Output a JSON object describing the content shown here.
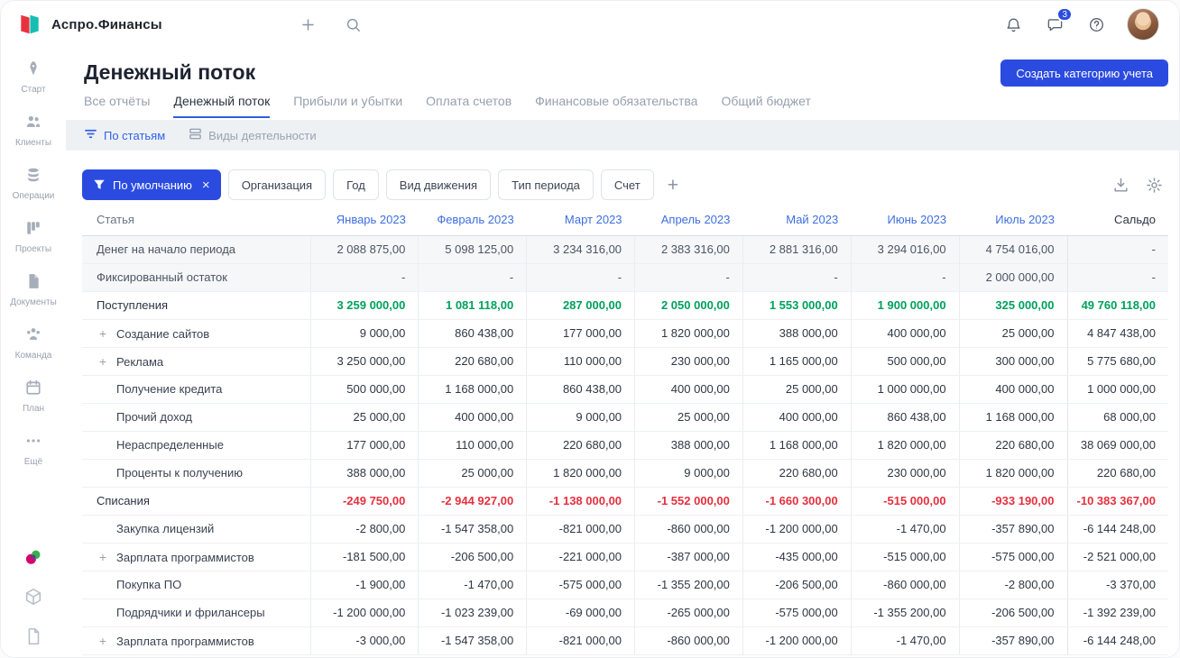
{
  "topbar": {
    "app_name": "Аспро.Финансы",
    "chat_badge": "3"
  },
  "sidebar": {
    "items": [
      {
        "label": "Старт",
        "icon": "rocket"
      },
      {
        "label": "Клиенты",
        "icon": "people"
      },
      {
        "label": "Операции",
        "icon": "coins"
      },
      {
        "label": "Проекты",
        "icon": "kanban"
      },
      {
        "label": "Документы",
        "icon": "doc"
      },
      {
        "label": "Команда",
        "icon": "team"
      },
      {
        "label": "План",
        "icon": "plan"
      },
      {
        "label": "Ещё",
        "icon": "more"
      }
    ]
  },
  "page": {
    "title": "Денежный поток",
    "create_button": "Создать категорию учета",
    "tabs": [
      {
        "label": "Все отчёты",
        "active": false
      },
      {
        "label": "Денежный поток",
        "active": true
      },
      {
        "label": "Прибыли и убытки",
        "active": false
      },
      {
        "label": "Оплата счетов",
        "active": false
      },
      {
        "label": "Финансовые обязательства",
        "active": false
      },
      {
        "label": "Общий бюджет",
        "active": false
      }
    ],
    "subtabs": [
      {
        "label": "По статьям",
        "icon": "by-articles",
        "active": true
      },
      {
        "label": "Виды деятельности",
        "icon": "activity",
        "active": false
      }
    ]
  },
  "filters": {
    "primary": "По умолчанию",
    "chips": [
      "Организация",
      "Год",
      "Вид движения",
      "Тип периода",
      "Счет"
    ]
  },
  "table": {
    "columns": [
      "Статья",
      "Январь 2023",
      "Февраль 2023",
      "Март 2023",
      "Апрель 2023",
      "Май 2023",
      "Июнь 2023",
      "Июль 2023",
      "Сальдо"
    ],
    "rows": [
      {
        "label": "Денег на начало периода",
        "style": "muted",
        "expandable": false,
        "child": false,
        "values": [
          "2 088 875,00",
          "5 098 125,00",
          "3 234 316,00",
          "2 383 316,00",
          "2 881 316,00",
          "3 294 016,00",
          "4 754 016,00",
          "-"
        ]
      },
      {
        "label": "Фиксированный остаток",
        "style": "muted",
        "expandable": false,
        "child": false,
        "values": [
          "-",
          "-",
          "-",
          "-",
          "-",
          "-",
          "2 000 000,00",
          "-"
        ]
      },
      {
        "label": "Поступления",
        "style": "green",
        "expandable": false,
        "child": false,
        "values": [
          "3 259 000,00",
          "1 081 118,00",
          "287 000,00",
          "2 050 000,00",
          "1 553 000,00",
          "1 900 000,00",
          "325 000,00",
          "49 760 118,00"
        ]
      },
      {
        "label": "Создание сайтов",
        "style": "",
        "expandable": true,
        "child": false,
        "values": [
          "9 000,00",
          "860 438,00",
          "177 000,00",
          "1 820 000,00",
          "388 000,00",
          "400 000,00",
          "25 000,00",
          "4 847 438,00"
        ]
      },
      {
        "label": "Реклама",
        "style": "",
        "expandable": true,
        "child": false,
        "values": [
          "3 250 000,00",
          "220 680,00",
          "110 000,00",
          "230 000,00",
          "1 165 000,00",
          "500 000,00",
          "300 000,00",
          "5 775 680,00"
        ]
      },
      {
        "label": "Получение кредита",
        "style": "",
        "expandable": false,
        "child": true,
        "values": [
          "500 000,00",
          "1 168 000,00",
          "860 438,00",
          "400 000,00",
          "25 000,00",
          "1 000 000,00",
          "400 000,00",
          "1 000 000,00"
        ]
      },
      {
        "label": "Прочий доход",
        "style": "",
        "expandable": false,
        "child": true,
        "values": [
          "25 000,00",
          "400 000,00",
          "9 000,00",
          "25 000,00",
          "400 000,00",
          "860 438,00",
          "1 168 000,00",
          "68 000,00"
        ]
      },
      {
        "label": "Нераспределенные",
        "style": "",
        "expandable": false,
        "child": true,
        "values": [
          "177 000,00",
          "110 000,00",
          "220 680,00",
          "388 000,00",
          "1 168 000,00",
          "1 820 000,00",
          "220 680,00",
          "38 069 000,00"
        ]
      },
      {
        "label": "Проценты к получению",
        "style": "",
        "expandable": false,
        "child": true,
        "values": [
          "388 000,00",
          "25 000,00",
          "1 820 000,00",
          "9 000,00",
          "220 680,00",
          "230 000,00",
          "1 820 000,00",
          "220 680,00"
        ]
      },
      {
        "label": "Списания",
        "style": "red",
        "expandable": false,
        "child": false,
        "values": [
          "-249 750,00",
          "-2 944 927,00",
          "-1 138 000,00",
          "-1 552 000,00",
          "-1 660 300,00",
          "-515 000,00",
          "-933 190,00",
          "-10 383 367,00"
        ]
      },
      {
        "label": "Закупка лицензий",
        "style": "",
        "expandable": false,
        "child": true,
        "values": [
          "-2 800,00",
          "-1 547 358,00",
          "-821 000,00",
          "-860 000,00",
          "-1 200 000,00",
          "-1 470,00",
          "-357 890,00",
          "-6 144 248,00"
        ]
      },
      {
        "label": "Зарплата программистов",
        "style": "",
        "expandable": true,
        "child": false,
        "values": [
          "-181 500,00",
          "-206 500,00",
          "-221 000,00",
          "-387 000,00",
          "-435 000,00",
          "-515 000,00",
          "-575 000,00",
          "-2 521 000,00"
        ]
      },
      {
        "label": "Покупка ПО",
        "style": "",
        "expandable": false,
        "child": true,
        "values": [
          "-1 900,00",
          "-1 470,00",
          "-575 000,00",
          "-1 355 200,00",
          "-206 500,00",
          "-860 000,00",
          "-2 800,00",
          "-3 370,00"
        ]
      },
      {
        "label": "Подрядчики и фрилансеры",
        "style": "",
        "expandable": false,
        "child": true,
        "values": [
          "-1 200 000,00",
          "-1 023 239,00",
          "-69 000,00",
          "-265 000,00",
          "-575 000,00",
          "-1 355 200,00",
          "-206 500,00",
          "-1 392 239,00"
        ]
      },
      {
        "label": "Зарплата программистов",
        "style": "",
        "expandable": true,
        "child": false,
        "values": [
          "-3 000,00",
          "-1 547 358,00",
          "-821 000,00",
          "-860 000,00",
          "-1 200 000,00",
          "-1 470,00",
          "-357 890,00",
          "-6 144 248,00"
        ]
      }
    ]
  },
  "colors": {
    "accent": "#2b4be0",
    "positive": "#00a15c",
    "negative": "#e5303e"
  }
}
